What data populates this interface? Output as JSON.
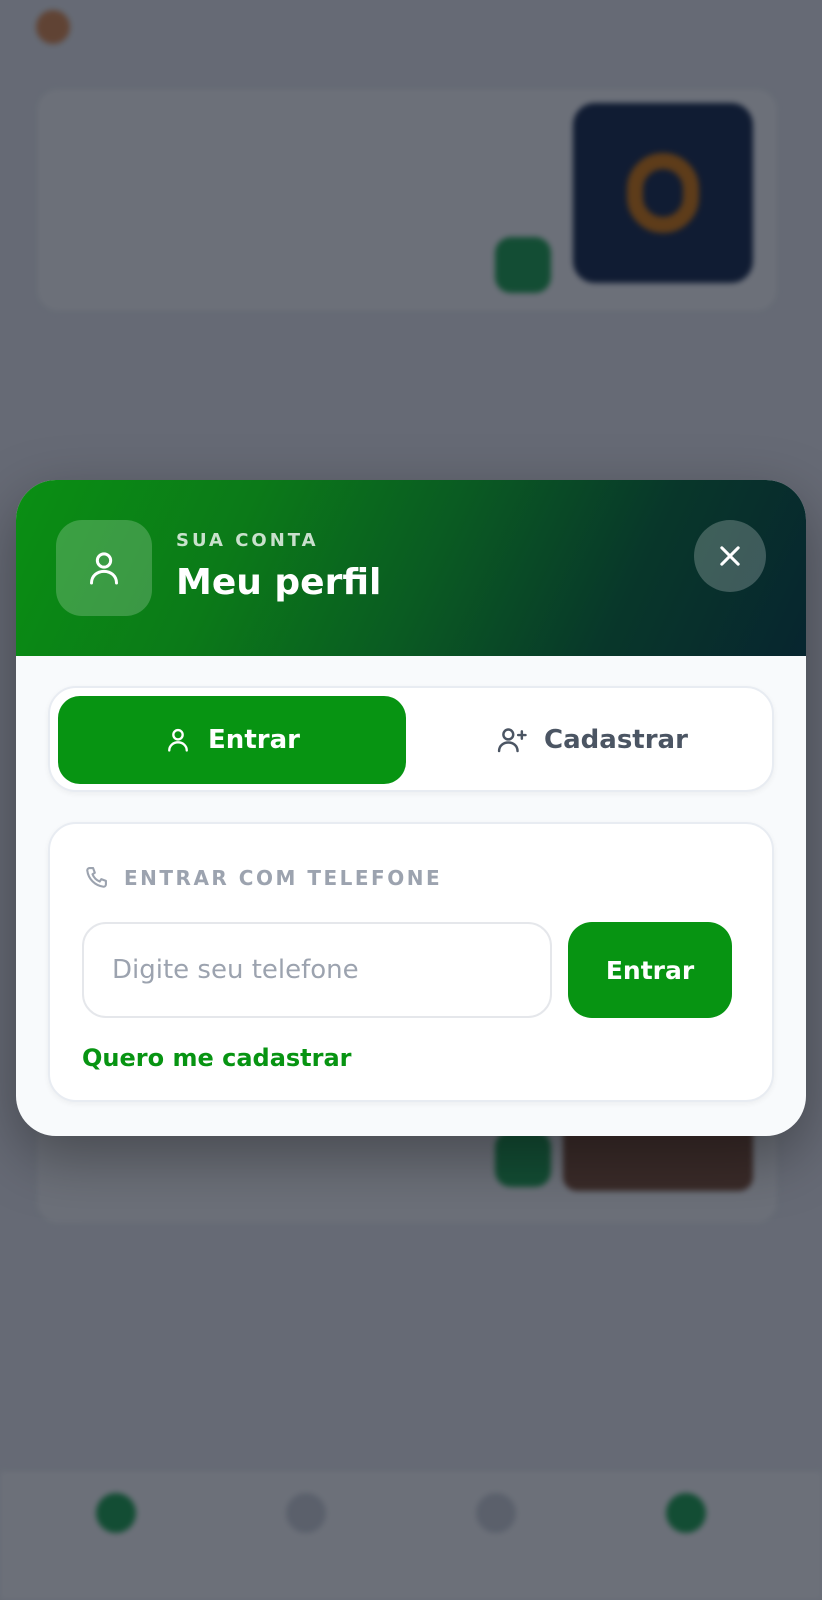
{
  "modal": {
    "eyebrow": "SUA CONTA",
    "title": "Meu perfil",
    "tabs": [
      {
        "label": "Entrar",
        "icon": "user-icon",
        "active": true
      },
      {
        "label": "Cadastrar",
        "icon": "user-plus-icon",
        "active": false
      }
    ],
    "login": {
      "section_label": "ENTRAR COM TELEFONE",
      "section_icon": "phone-icon",
      "phone_placeholder": "Digite seu telefone",
      "phone_value": "",
      "submit_label": "Entrar",
      "signup_link": "Quero me cadastrar"
    },
    "close_icon": "close-icon"
  },
  "colors": {
    "brand_green": "#079412",
    "header_gradient_end": "#07252f",
    "overlay": "rgba(17,24,39,0.62)"
  }
}
